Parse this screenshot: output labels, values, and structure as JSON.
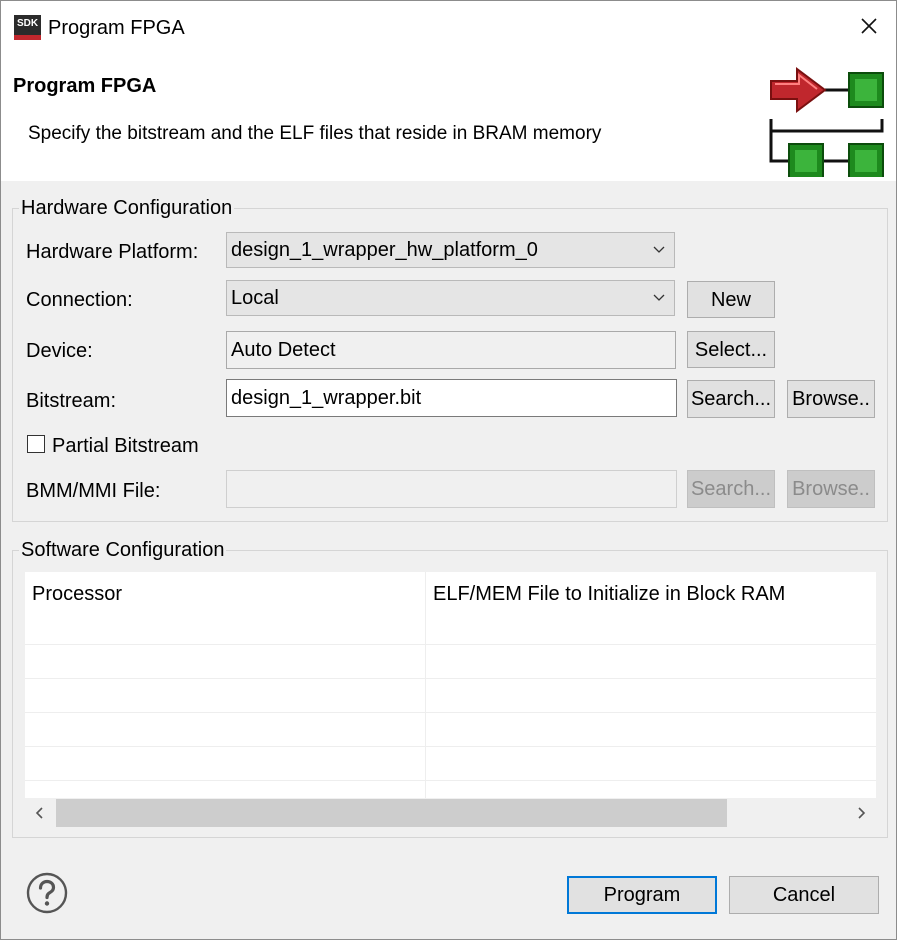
{
  "window": {
    "icon_text": "SDK",
    "title": "Program FPGA"
  },
  "header": {
    "title": "Program FPGA",
    "description": "Specify the bitstream and the ELF files that reside in BRAM memory"
  },
  "hardware": {
    "group_label": "Hardware Configuration",
    "platform_label": "Hardware Platform:",
    "platform_value": "design_1_wrapper_hw_platform_0",
    "connection_label": "Connection:",
    "connection_value": "Local",
    "new_button": "New",
    "device_label": "Device:",
    "device_value": "Auto Detect",
    "select_button": "Select...",
    "bitstream_label": "Bitstream:",
    "bitstream_value": "design_1_wrapper.bit",
    "search_button": "Search...",
    "browse_button": "Browse..",
    "partial_label": "Partial Bitstream",
    "partial_checked": false,
    "bmm_label": "BMM/MMI File:",
    "bmm_value": "",
    "bmm_search_button": "Search...",
    "bmm_browse_button": "Browse.."
  },
  "software": {
    "group_label": "Software Configuration",
    "columns": [
      "Processor",
      "ELF/MEM File to Initialize in Block RAM"
    ]
  },
  "footer": {
    "program_button": "Program",
    "cancel_button": "Cancel"
  },
  "colors": {
    "accent_border": "#0078d7",
    "logo_red": "#c1272d",
    "graphic_green": "#1e8a1e"
  }
}
